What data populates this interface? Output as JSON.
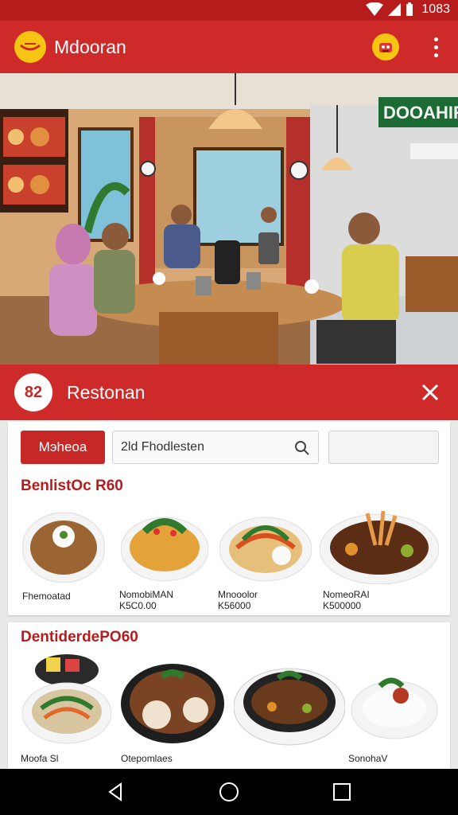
{
  "status_bar": {
    "time": "1083",
    "icons": [
      "wifi-icon",
      "signal-icon",
      "battery-icon"
    ]
  },
  "app_bar": {
    "title": "Mdooran",
    "logo_icon": "logo-icon",
    "cart_icon": "cart-icon",
    "menu_icon": "more-vert-icon"
  },
  "hero": {
    "sign_text": "DOOAHIR"
  },
  "restaurant": {
    "badge": "82",
    "name": "Restonan",
    "close_icon": "close-icon"
  },
  "filter": {
    "chip_label": "Mэheoa",
    "search_value": "2ld Fhodlesten",
    "search_icon": "search-icon"
  },
  "section1": {
    "title": "BenlistOc R60",
    "items": [
      {
        "name": "Fhemoatad",
        "price": ""
      },
      {
        "name": "NomobiMAN",
        "price": "K5C0.00"
      },
      {
        "name": "Mnooolor",
        "price": "K56000"
      },
      {
        "name": "NomeoRAI",
        "price": "K500000"
      }
    ]
  },
  "section2": {
    "title": "DentiderdePO60",
    "items": [
      {
        "name": "Moofa Sl",
        "price": ""
      },
      {
        "name": "Otepomlaes",
        "price": ""
      },
      {
        "name": "",
        "price": ""
      },
      {
        "name": "SonohaV",
        "price": ""
      }
    ]
  },
  "colors": {
    "primary": "#cf2a2a",
    "dark_primary": "#b71c1c",
    "accent": "#f6c511"
  },
  "nav": {
    "back_icon": "back-icon",
    "home_icon": "home-icon",
    "recents_icon": "recents-icon"
  }
}
